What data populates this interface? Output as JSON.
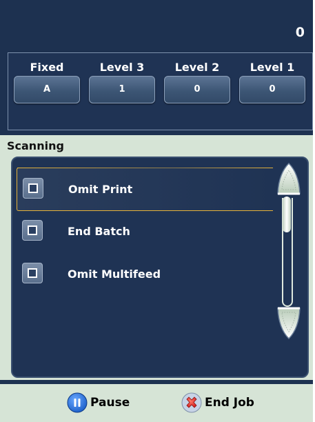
{
  "header": {
    "count": "0"
  },
  "levels": [
    {
      "label": "Fixed",
      "value": "A"
    },
    {
      "label": "Level 3",
      "value": "1"
    },
    {
      "label": "Level 2",
      "value": "0"
    },
    {
      "label": "Level 1",
      "value": "0"
    }
  ],
  "scanning": {
    "title": "Scanning",
    "items": [
      {
        "label": "Omit Print",
        "checked": false,
        "selected": true
      },
      {
        "label": "End Batch",
        "checked": false,
        "selected": false
      },
      {
        "label": "Omit Multifeed",
        "checked": false,
        "selected": false
      }
    ],
    "scroll_position": 0.0
  },
  "actions": {
    "pause_label": "Pause",
    "pause_icon": "pause-icon",
    "end_job_label": "End Job",
    "end_job_icon": "x-icon"
  },
  "colors": {
    "background": "#1d3150",
    "panel": "#d6e4d6",
    "selection": "#e8b43a",
    "pause_blue": "#1a5ec8",
    "end_red": "#d42020"
  }
}
